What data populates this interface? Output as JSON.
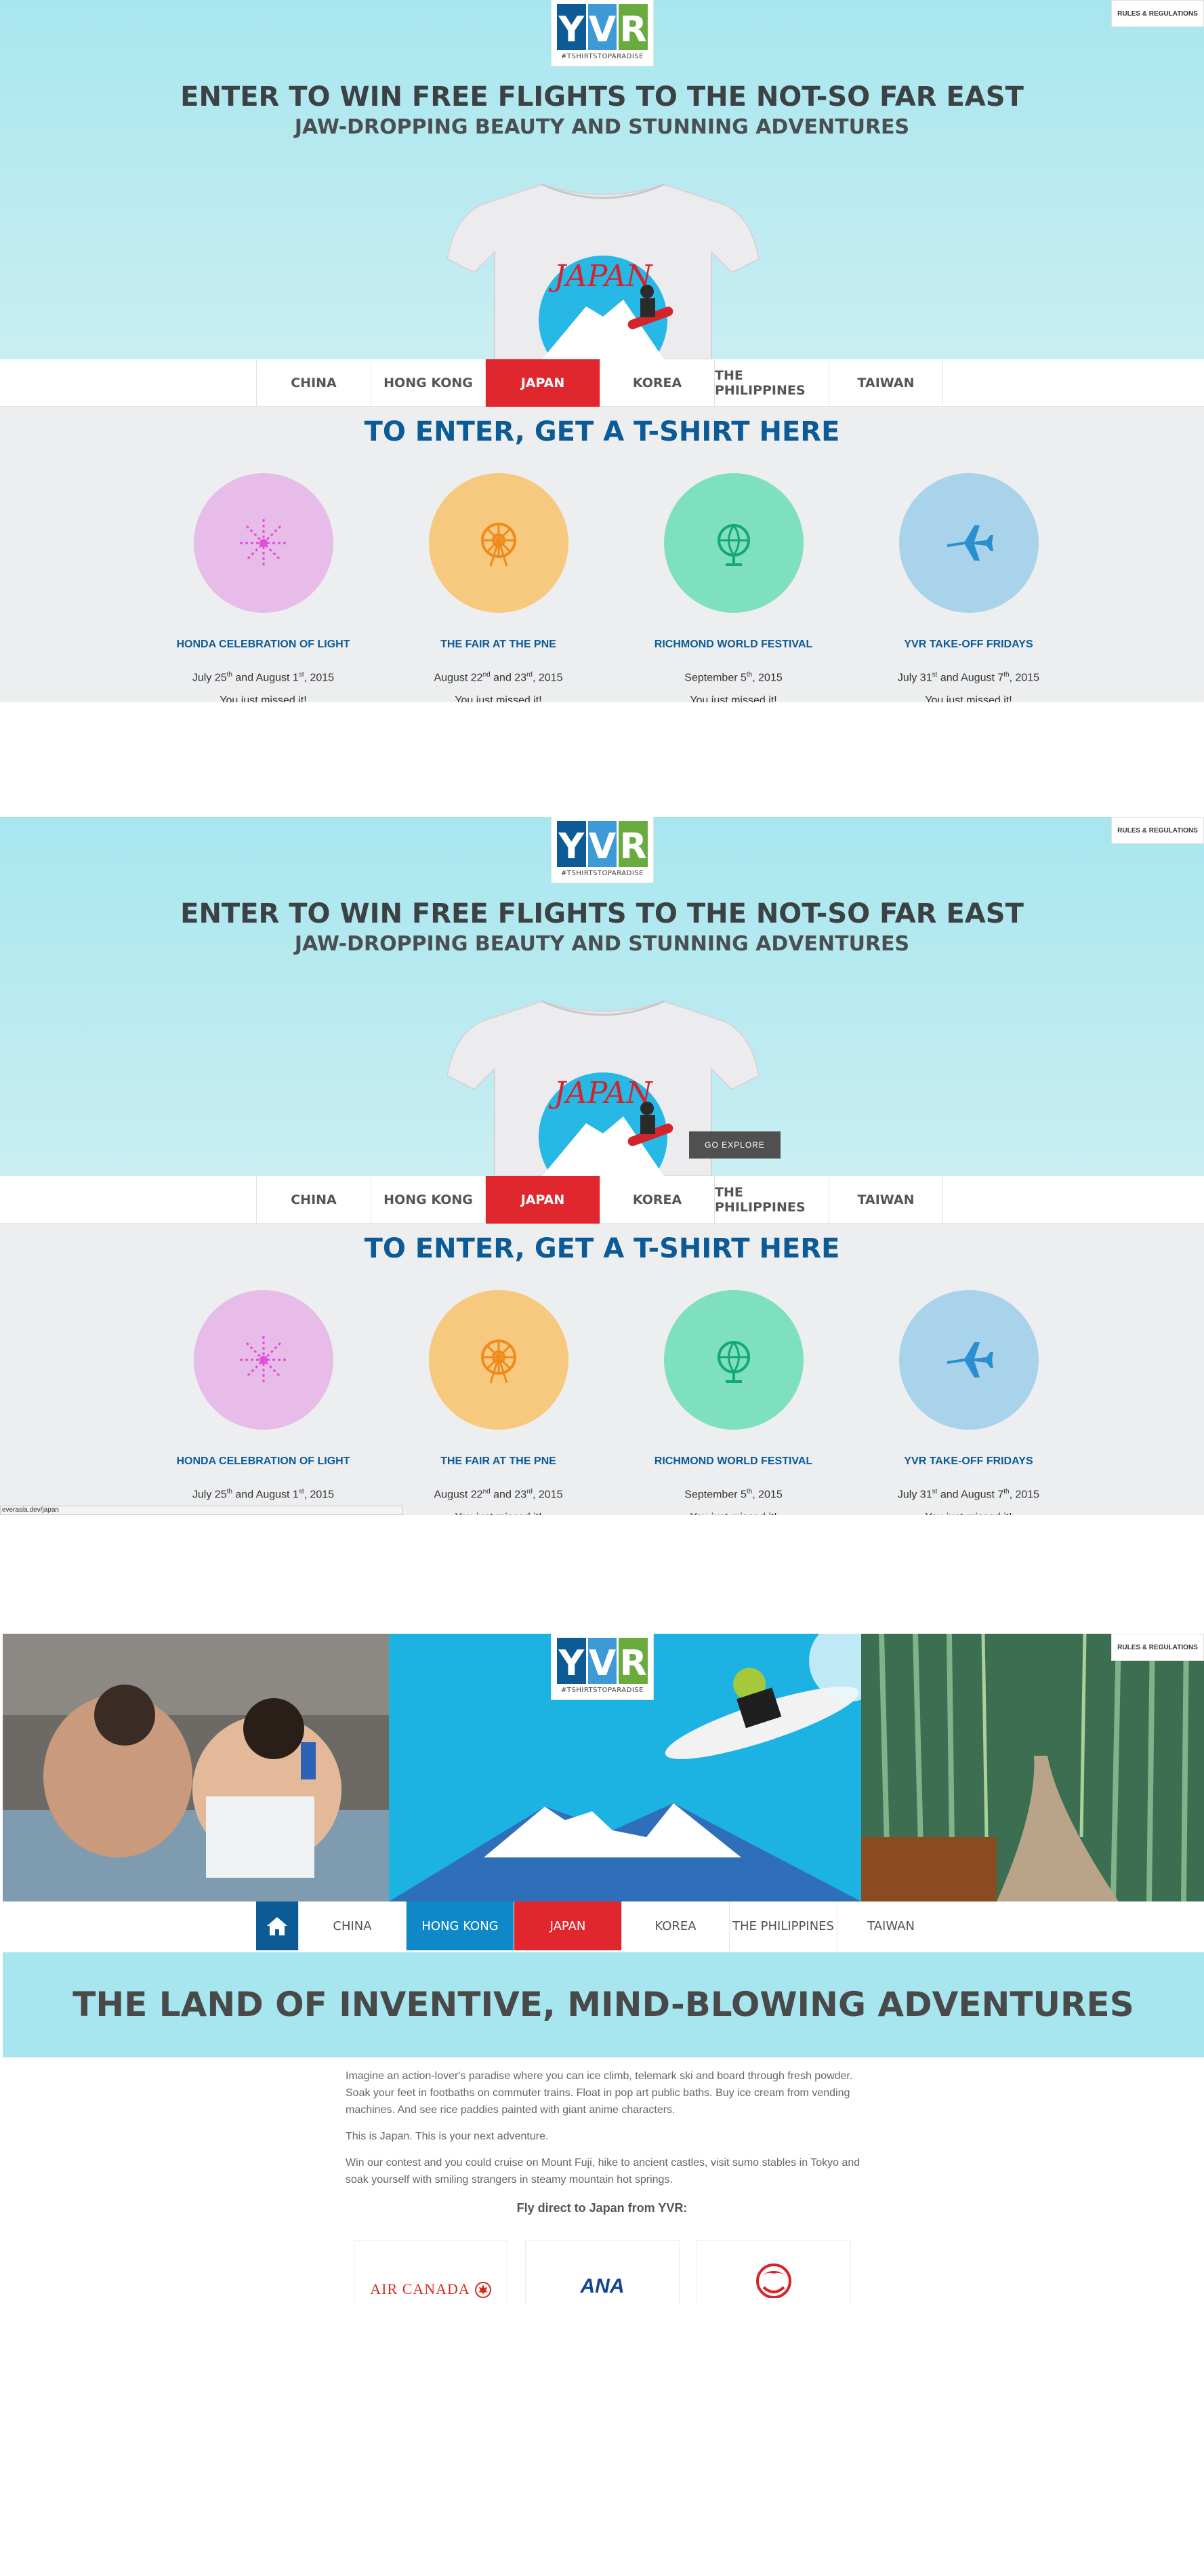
{
  "header": {
    "logo_letters": [
      "Y",
      "V",
      "R"
    ],
    "logo_tagline": "#TSHIRTSTOPARADISE",
    "rules_button": "RULES & REGULATIONS",
    "headline": "ENTER TO WIN FREE FLIGHTS TO THE NOT-SO FAR EAST",
    "subheadline": "JAW-DROPPING BEAUTY AND STUNNING ADVENTURES",
    "shirt_text": "JAPAN",
    "explore_button": "GO EXPLORE"
  },
  "tabs": [
    {
      "label": "CHINA",
      "active": false
    },
    {
      "label": "HONG KONG",
      "active": false
    },
    {
      "label": "JAPAN",
      "active": true
    },
    {
      "label": "KOREA",
      "active": false
    },
    {
      "label": "THE PHILIPPINES",
      "active": false
    },
    {
      "label": "TAIWAN",
      "active": false
    }
  ],
  "enter_section": {
    "title": "TO ENTER, GET A T-SHIRT HERE",
    "events": [
      {
        "name": "HONDA CELEBRATION OF LIGHT",
        "date_a": "July 25",
        "sup_a": "th",
        "date_mid": " and August 1",
        "sup_b": "st",
        "date_end": ", 2015",
        "missed": "You just missed it!",
        "icon": "fireworks-icon",
        "color": "#e7bce9"
      },
      {
        "name": "THE FAIR AT THE PNE",
        "date_a": "August 22",
        "sup_a": "nd",
        "date_mid": " and 23",
        "sup_b": "rd",
        "date_end": ", 2015",
        "missed": "You just missed it!",
        "icon": "ferris-wheel-icon",
        "color": "#f7c97e"
      },
      {
        "name": "RICHMOND WORLD FESTIVAL",
        "date_a": "September 5",
        "sup_a": "th",
        "date_mid": ", 2015",
        "sup_b": "",
        "date_end": "",
        "missed": "You just missed it!",
        "icon": "globe-icon",
        "color": "#7fe0bf"
      },
      {
        "name": "YVR TAKE-OFF FRIDAYS",
        "date_a": "July 31",
        "sup_a": "st",
        "date_mid": " and August 7",
        "sup_b": "th",
        "date_end": ", 2015",
        "missed": "You just missed it!",
        "icon": "airplane-icon",
        "color": "#a9d3ea"
      }
    ]
  },
  "status_bar": {
    "url": "everasia.dev/japan"
  },
  "japan_page": {
    "tabs": [
      {
        "label": "CHINA"
      },
      {
        "label": "HONG KONG"
      },
      {
        "label": "JAPAN"
      },
      {
        "label": "KOREA"
      },
      {
        "label": "THE PHILIPPINES"
      },
      {
        "label": "TAIWAN"
      }
    ],
    "band_title": "THE LAND OF INVENTIVE, MIND-BLOWING ADVENTURES",
    "paragraphs": [
      "Imagine an action-lover's paradise where you can ice climb, telemark ski and board through fresh powder. Soak your feet in footbaths on commuter trains. Float in pop art public baths. Buy ice cream from vending machines. And see rice paddies painted with giant anime characters.",
      "This is Japan. This is your next adventure.",
      "Win our contest and you could cruise on Mount Fuji, hike to ancient castles, visit sumo stables in Tokyo and soak yourself with smiling strangers in steamy mountain hot springs."
    ],
    "fly_heading": "Fly direct to Japan from YVR:",
    "airlines": [
      "AIR CANADA",
      "ANA"
    ]
  },
  "colors": {
    "brand_blue": "#0c5b96",
    "active_red": "#e0272d",
    "hero_cyan": "#a8e6ef",
    "hk_blue": "#0e88c6"
  }
}
